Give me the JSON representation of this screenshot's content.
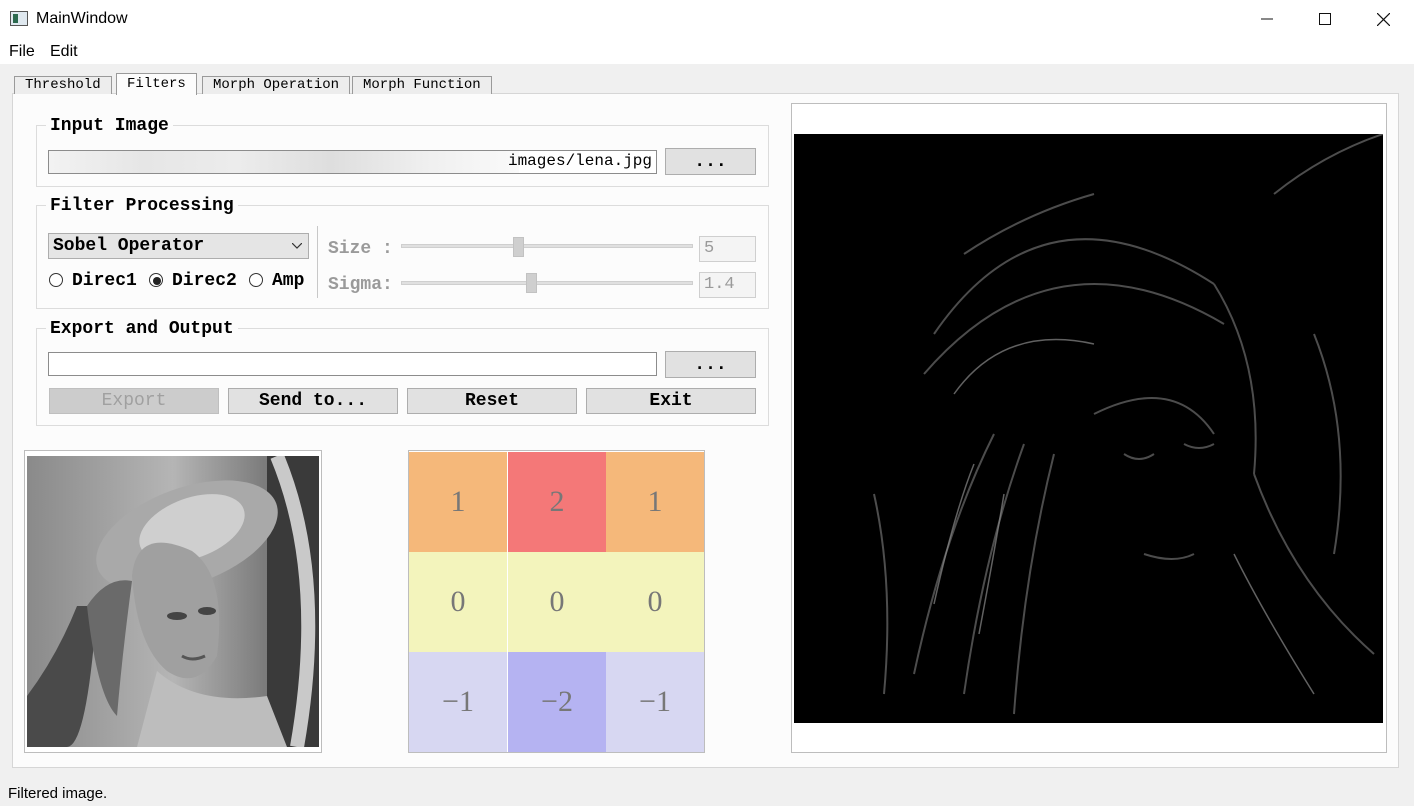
{
  "window": {
    "title": "MainWindow",
    "minimize": "—",
    "maximize": "☐",
    "close": "✕"
  },
  "menu": {
    "file": "File",
    "edit": "Edit"
  },
  "tabs": [
    {
      "label": "Threshold"
    },
    {
      "label": "Filters"
    },
    {
      "label": "Morph Operation"
    },
    {
      "label": "Morph Function"
    }
  ],
  "input_image": {
    "title": "Input Image",
    "path": "images/lena.jpg",
    "browse_label": "..."
  },
  "filter": {
    "title": "Filter Processing",
    "selected_filter": "Sobel Operator",
    "radios": [
      {
        "label": "Direc1",
        "checked": false
      },
      {
        "label": "Direc2",
        "checked": true
      },
      {
        "label": "Amp",
        "checked": false
      }
    ],
    "size_label": "Size :",
    "size_value": "5",
    "sigma_label": "Sigma:",
    "sigma_value": "1.4"
  },
  "export": {
    "title": "Export and Output",
    "path": "",
    "browse_label": "...",
    "export_label": "Export",
    "send_label": "Send to...",
    "reset_label": "Reset",
    "exit_label": "Exit"
  },
  "kernel": {
    "rows": [
      [
        "1",
        "2",
        "1"
      ],
      [
        "0",
        "0",
        "0"
      ],
      [
        "−1",
        "−2",
        "−1"
      ]
    ],
    "colors": [
      [
        "#f5b87a",
        "#f47878",
        "#f5b87a"
      ],
      [
        "#f3f4bc",
        "#f3f4bc",
        "#f3f4bc"
      ],
      [
        "#d7d7f2",
        "#b5b3f2",
        "#d7d7f2"
      ]
    ]
  },
  "status": {
    "text": "Filtered image."
  }
}
